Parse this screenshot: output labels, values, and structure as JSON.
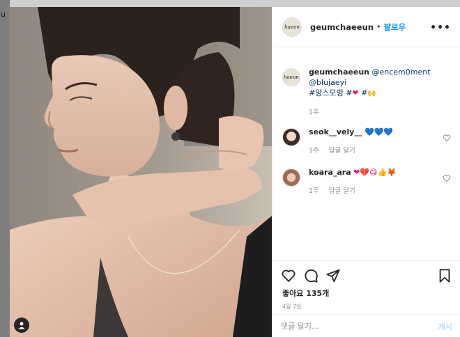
{
  "header": {
    "avatar_text": "haeun",
    "username": "geumchaeeun",
    "separator": "•",
    "follow_label": "팔로우",
    "more_label": "•••"
  },
  "caption": {
    "username": "geumchaeeun",
    "mention_1": "@encem0ment",
    "mention_2": "@blujaeyi",
    "hashtag_1": "#앙스모멍",
    "hashtag_2_prefix": "#",
    "hashtag_2_emoji": "❤",
    "hashtag_3_prefix": "#",
    "hashtag_3_emoji": "🙌",
    "time": "1주"
  },
  "comments": [
    {
      "username": "seok__vely__",
      "text": "💙💙💙",
      "time": "1주",
      "reply_label": "답글 달기"
    },
    {
      "username": "koara_ara",
      "text": "❤💔😋👍🦊",
      "time": "1주",
      "reply_label": "답글 달기"
    }
  ],
  "actions": {
    "likes": "좋아요 135개",
    "date": "4월 7일"
  },
  "add_comment": {
    "placeholder": "댓글 달기...",
    "post_label": "게시"
  },
  "left_edge_text": "u",
  "colors": {
    "accent": "#0095f6",
    "link": "#00376b",
    "muted": "#8e8e8e",
    "post_disabled": "#b2dffc"
  }
}
